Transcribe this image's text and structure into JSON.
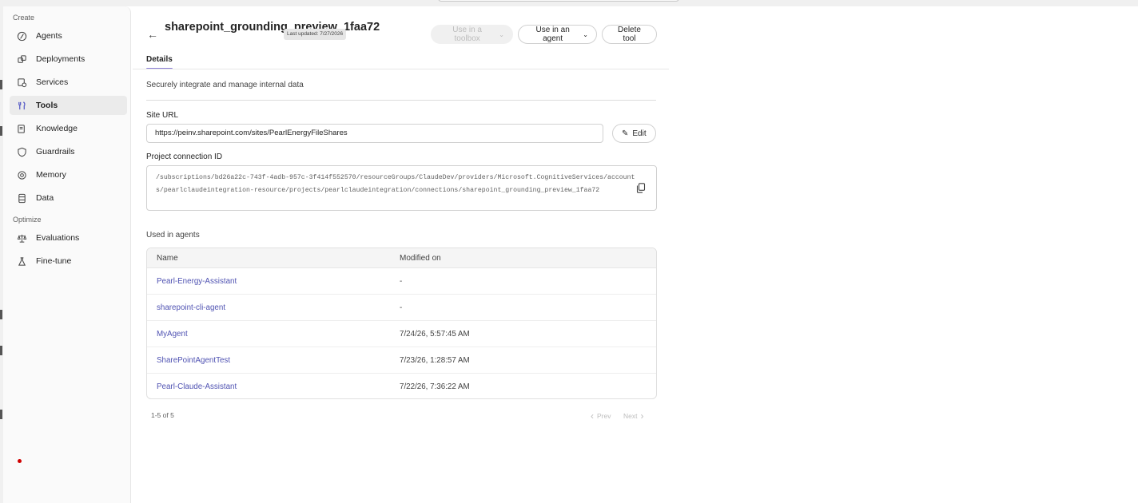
{
  "sidebar": {
    "create_label": "Create",
    "optimize_label": "Optimize",
    "items": [
      {
        "label": "Agents",
        "icon": "agents-icon"
      },
      {
        "label": "Deployments",
        "icon": "deployments-icon"
      },
      {
        "label": "Services",
        "icon": "services-icon"
      },
      {
        "label": "Tools",
        "icon": "tools-icon",
        "active": true
      },
      {
        "label": "Knowledge",
        "icon": "knowledge-icon"
      },
      {
        "label": "Guardrails",
        "icon": "guardrails-icon"
      },
      {
        "label": "Memory",
        "icon": "memory-icon"
      },
      {
        "label": "Data",
        "icon": "data-icon"
      }
    ],
    "optimize_items": [
      {
        "label": "Evaluations",
        "icon": "evaluations-icon"
      },
      {
        "label": "Fine-tune",
        "icon": "fine-tune-icon"
      }
    ]
  },
  "header": {
    "title": "sharepoint_grounding_preview_1faa72",
    "last_updated": "Last updated: 7/27/2026",
    "use_in_toolbox": "Use in a toolbox",
    "use_in_agent": "Use in an agent",
    "delete_tool": "Delete tool"
  },
  "tabs": {
    "details": "Details"
  },
  "details": {
    "description": "Securely integrate and manage internal data",
    "site_url_label": "Site URL",
    "site_url_value": "https://peinv.sharepoint.com/sites/PearlEnergyFileShares",
    "edit_label": "Edit",
    "connection_label": "Project connection ID",
    "connection_value": "/subscriptions/bd26a22c-743f-4adb-957c-3f414f552570/resourceGroups/ClaudeDev/providers/Microsoft.CognitiveServices/accounts/pearlclaudeintegration-resource/projects/pearlclaudeintegration/connections/sharepoint_grounding_preview_1faa72"
  },
  "agents": {
    "title": "Used in agents",
    "columns": [
      "Name",
      "Modified on"
    ],
    "rows": [
      {
        "name": "Pearl-Energy-Assistant",
        "modified": "-"
      },
      {
        "name": "sharepoint-cli-agent",
        "modified": "-"
      },
      {
        "name": "MyAgent",
        "modified": "7/24/26, 5:57:45 AM"
      },
      {
        "name": "SharePointAgentTest",
        "modified": "7/23/26, 1:28:57 AM"
      },
      {
        "name": "Pearl-Claude-Assistant",
        "modified": "7/22/26, 7:36:22 AM"
      }
    ],
    "count": "1-5 of 5",
    "prev": "Prev",
    "next": "Next"
  },
  "colors": {
    "accent": "#8b7fd6",
    "link": "#4f52b2",
    "sidebar_bg": "#fafafa"
  }
}
